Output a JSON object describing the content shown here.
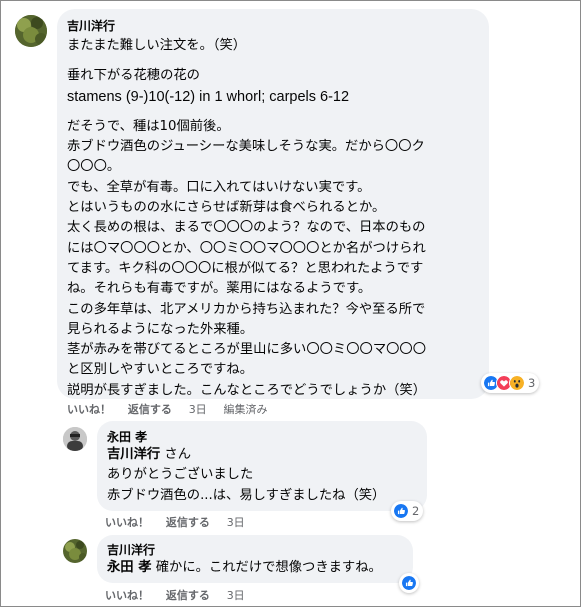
{
  "comment1": {
    "author": "吉川洋行",
    "lines": [
      "またまた難しい注文を。（笑）",
      "",
      "垂れ下がる花穂の花の",
      "stamens (9-)10(-12) in 1 whorl; carpels 6-12",
      "",
      "だそうで、種は10個前後。",
      "赤ブドウ酒色のジューシーな美味しそうな実。だから〇〇ク",
      "〇〇〇。",
      "でも、全草が有毒。口に入れてはいけない実です。",
      "とはいうものの水にさらせば新芽は食べられるとか。",
      "太く長めの根は、まるで〇〇〇のよう？なので、日本のもの",
      "には〇マ〇〇〇とか、〇〇ミ〇〇マ〇〇〇とか名がつけられ",
      "てます。キク科の〇〇〇に根が似てる？と思われたようです",
      "ね。それらも有毒ですが。薬用にはなるようです。",
      "この多年草は、北アメリカから持ち込まれた？今や至る所で",
      "見られるようになった外来種。",
      "茎が赤みを帯びてるところが里山に多い〇〇ミ〇〇マ〇〇〇",
      "と区別しやすいところですね。",
      "説明が長すぎました。こんなところでどうでしょうか（笑）"
    ],
    "reaction_count": "3",
    "actions": {
      "like": "いいね！",
      "reply": "返信する",
      "time": "3日",
      "edited": "編集済み"
    }
  },
  "reply1": {
    "author": "永田 孝",
    "mention": "吉川洋行",
    "mention_suffix": " さん",
    "lines": [
      "ありがとうございました",
      "赤ブドウ酒色の...は、易しすぎましたね（笑）"
    ],
    "reaction_count": "2",
    "actions": {
      "like": "いいね！",
      "reply": "返信する",
      "time": "3日"
    }
  },
  "reply2": {
    "author": "吉川洋行",
    "mention": "永田 孝",
    "text": " 確かに。これだけで想像つきますね。",
    "actions": {
      "like": "いいね！",
      "reply": "返信する",
      "time": "3日"
    }
  },
  "colors": {
    "bubble": "#f0f2f5",
    "meta_text": "#65676b",
    "like_blue": "#1877f2",
    "love_red": "#f33e58",
    "haha_yellow": "#f7b125"
  }
}
